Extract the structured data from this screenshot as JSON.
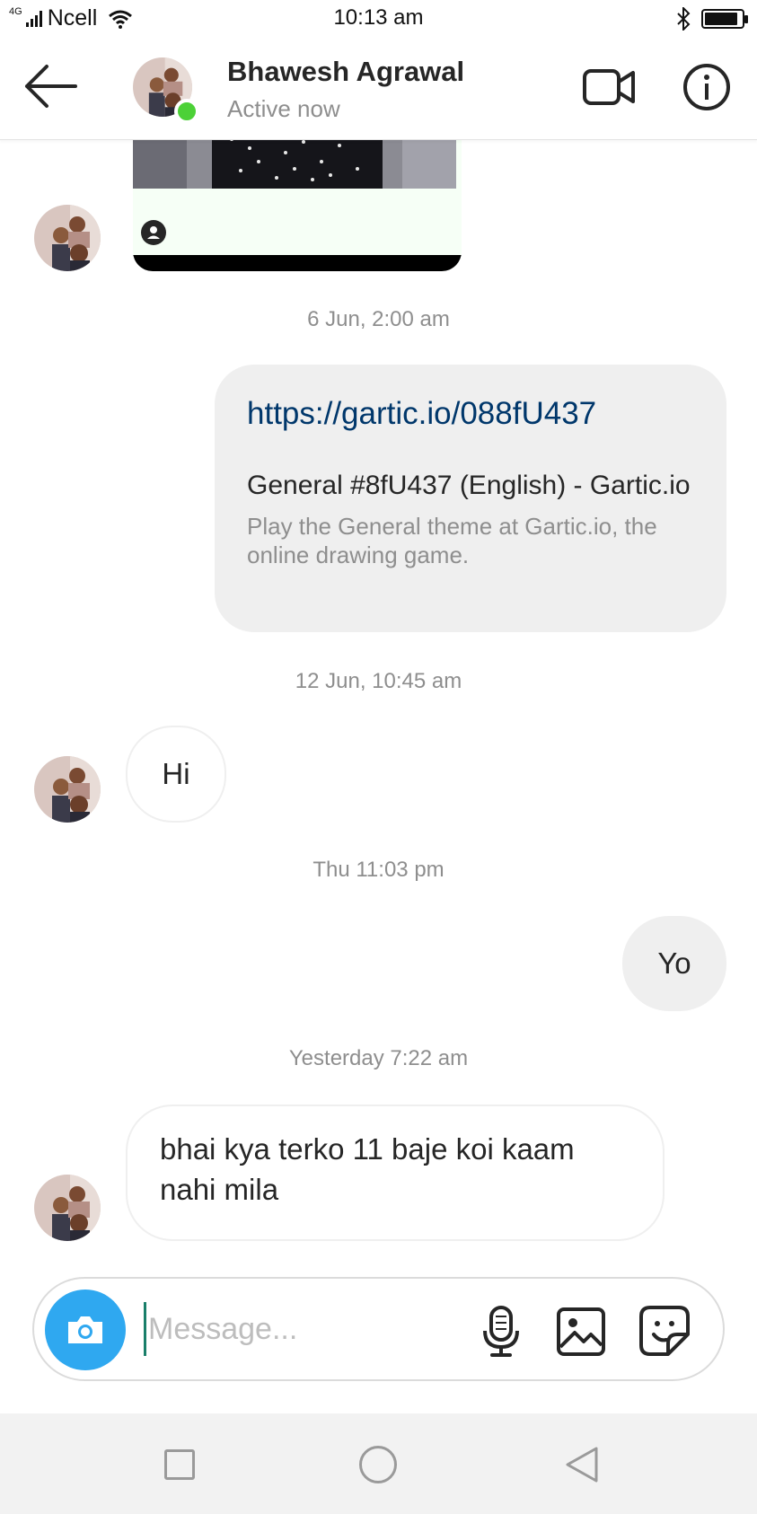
{
  "status_bar": {
    "network_type": "4G",
    "carrier": "Ncell",
    "time": "10:13 am",
    "battery_level": 0.9
  },
  "header": {
    "back_icon": "arrow-left-icon",
    "name": "Bhawesh Agrawal",
    "status": "Active now",
    "video_icon": "video-camera-icon",
    "info_icon": "info-icon",
    "online_color": "#4cd137"
  },
  "conversation": {
    "timestamps": [
      "6 Jun, 2:00 am",
      "12 Jun, 10:45 am",
      "Thu 11:03 pm",
      "Yesterday 7:22 am"
    ],
    "link_preview": {
      "url": "https://gartic.io/088fU437",
      "title": "General #8fU437 (English) - Gartic.io",
      "description": "Play the General theme at Gartic.io, the online drawing game."
    },
    "messages": [
      {
        "direction": "incoming",
        "text": "Hi"
      },
      {
        "direction": "outgoing",
        "text": "Yo"
      },
      {
        "direction": "incoming",
        "text": "bhai kya terko 11 baje koi kaam nahi mila"
      }
    ]
  },
  "composer": {
    "placeholder": "Message...",
    "value": "",
    "camera_icon": "camera-icon",
    "mic_icon": "microphone-icon",
    "gallery_icon": "image-icon",
    "sticker_icon": "sticker-icon",
    "accent_color": "#2fa8f0"
  },
  "nav_bar": {
    "icons": [
      "recent-apps-icon",
      "home-icon",
      "back-icon"
    ]
  }
}
